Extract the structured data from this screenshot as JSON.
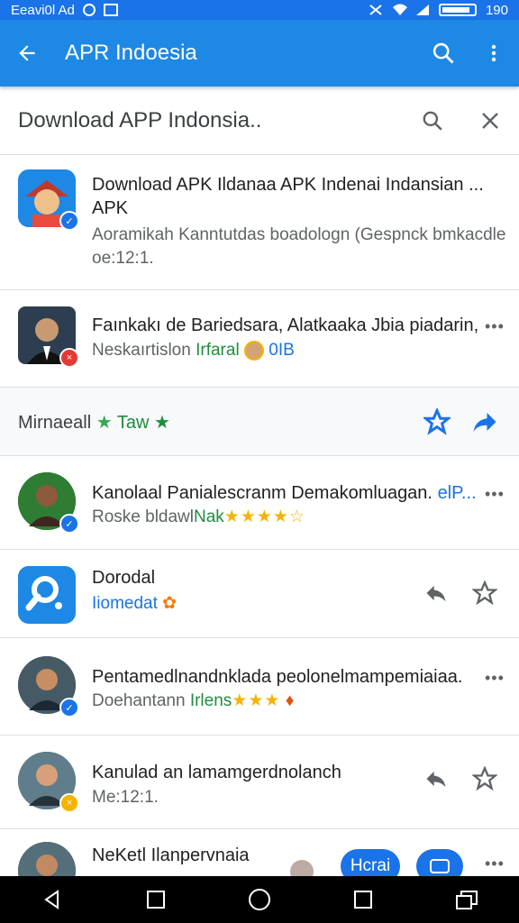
{
  "status": {
    "left_text": "Eeavi0l Ad",
    "time": "190"
  },
  "appbar": {
    "title": "APR Indoesia"
  },
  "search": {
    "query": "Download APP  Indonsia.."
  },
  "results": [
    {
      "title": "Download APK Ildanaa APK Indenai Indansian ...",
      "title2": "APK",
      "subtitle": "Aoramikah Kanntutdas boadologn (Gespnck bmkacdle",
      "meta": "oe:12:1."
    },
    {
      "title": "Faınkakı de Bariedsara, Alatkaaka Jbia piadarin,",
      "subtitle": "Neskaırtislon",
      "subtitle_green": "Irfaral",
      "subtitle_blue": "0IB"
    },
    {
      "label": "Mirnaeall",
      "label_green": "Taw"
    },
    {
      "title": "Kanolaal Panialescranm Demakomluagan.",
      "title_blue": "elP...",
      "subtitle": "Roske bldawl",
      "subtitle_green": "Nak",
      "stars": "★★★★☆"
    },
    {
      "title": "Dorodal",
      "subtitle": "Iiomedat"
    },
    {
      "title": "Pentamedlnandnklada peolonelmampemiaiaa.",
      "subtitle": "Doehantann",
      "subtitle_green": "Irlens",
      "stars": "★★★"
    },
    {
      "title": "Kanulad an lamamgerdnolanch",
      "subtitle": "Me:12:1."
    },
    {
      "title": "NeKetl Ilanpervnaia",
      "pill1": "Hcrai",
      "pill2": ""
    }
  ],
  "colors": {
    "appbar": "#1e88e5",
    "accent": "#1a73e8",
    "green": "#1e8e3e",
    "star": "#f4b400"
  }
}
